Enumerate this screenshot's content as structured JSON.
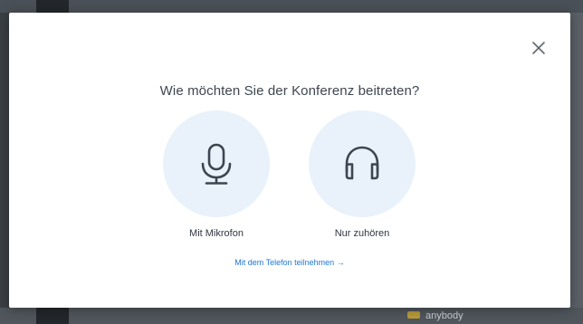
{
  "background": {
    "bottom_text": "anybody"
  },
  "modal": {
    "title": "Wie möchten Sie der Konferenz beitreten?",
    "close_icon": "close-icon",
    "options": [
      {
        "label": "Mit Mikrofon",
        "icon": "microphone-icon"
      },
      {
        "label": "Nur zuhören",
        "icon": "headphones-icon"
      }
    ],
    "phone_link": "Mit dem Telefon teilnehmen →"
  },
  "colors": {
    "accent": "#1f77d6",
    "option_bg": "#e9f2fb",
    "icon": "#3d4650"
  }
}
